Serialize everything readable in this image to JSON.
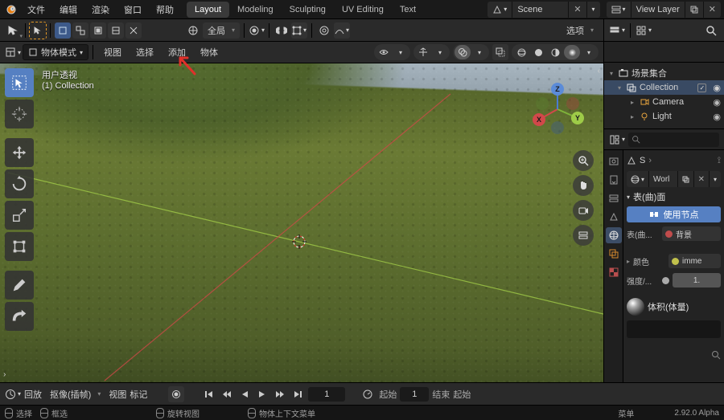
{
  "colors": {
    "accent": "#5680c2",
    "axis_x": "#d1484a",
    "axis_y": "#7fb33a",
    "axis_z": "#4b7bd1"
  },
  "topbar": {
    "menus": [
      "文件",
      "编辑",
      "渲染",
      "窗口",
      "帮助"
    ],
    "tabs": [
      "Layout",
      "Modeling",
      "Sculpting",
      "UV Editing",
      "Text"
    ],
    "active_tab": 0,
    "scene_label": "Scene",
    "layer_label": "View Layer"
  },
  "toolstrip": {
    "orientation": "全局",
    "options_label": "选项"
  },
  "viewport": {
    "mode": "物体模式",
    "menus": [
      "视图",
      "选择",
      "添加",
      "物体"
    ],
    "info_line1": "用户透视",
    "info_line2": "(1) Collection",
    "gizmo": {
      "x": "X",
      "y": "Y",
      "z": "Z"
    }
  },
  "outliner": {
    "title": "场景集合",
    "items": [
      {
        "name": "Collection",
        "icon": "collection",
        "checked": true
      },
      {
        "name": "Camera",
        "icon": "camera",
        "indent": 1
      },
      {
        "name": "Light",
        "icon": "light",
        "indent": 1
      }
    ]
  },
  "properties": {
    "breadcrumb_scene": "S",
    "world_name": "Worl",
    "panel_surface": "表(曲)面",
    "use_nodes": "使用节点",
    "rows": {
      "surface": {
        "k": "表(曲...",
        "v": "背景",
        "dot": "#c14c4c"
      },
      "color": {
        "k": "颜色",
        "v": "imme",
        "dot": "#c1c14c"
      },
      "strength": {
        "k": "强度/...",
        "v": "1."
      }
    },
    "panel_volume": "体积(体量)"
  },
  "timeline": {
    "menus": [
      "回放",
      "抠像(插帧)",
      "视图",
      "标记"
    ],
    "current": "1",
    "start_label": "起始",
    "start": "1",
    "end_label": "结束",
    "end_extra": "起始"
  },
  "status": {
    "items": [
      "选择",
      "框选",
      "旋转视图",
      "物体上下文菜单",
      "菜单"
    ],
    "version": "2.92.0 Alpha"
  }
}
